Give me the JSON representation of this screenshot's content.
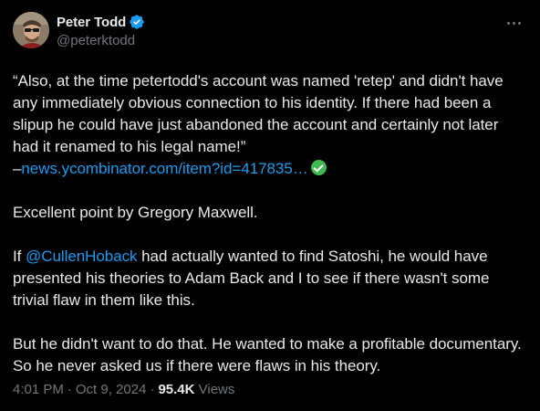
{
  "author": {
    "display_name": "Peter Todd",
    "handle": "@peterktodd"
  },
  "icons": {
    "verified": "verified-badge-icon",
    "more": "more-horizontal-icon",
    "check": "white-check-mark-emoji"
  },
  "colors": {
    "background": "#000000",
    "text": "#e7e9ea",
    "secondary": "#71767b",
    "link": "#1d9bf0",
    "verified": "#1d9bf0",
    "check_emoji": "#3fb950"
  },
  "tweet": {
    "quote": "“Also, at the time petertodd's account was named 'retep' and didn't have any immediately obvious connection to his identity. If there had been a slipup he could have just abandoned the account and certainly not later had it renamed to his legal name!”",
    "source_prefix": "–",
    "source_link": "news.ycombinator.com/item?id=417835…",
    "para2": "Excellent point by Gregory Maxwell.",
    "para3_before": "If ",
    "para3_mention": "@CullenHoback",
    "para3_after": " had actually wanted to find Satoshi, he would have presented his theories to Adam Back and I to see if there wasn't some trivial flaw in them like this.",
    "para4": "But he didn't want to do that. He wanted to make a profitable documentary. So he never asked us if there were flaws in his theory."
  },
  "meta": {
    "time": "4:01 PM",
    "separator": "·",
    "date": "Oct 9, 2024",
    "views_count": "95.4K",
    "views_label": "Views"
  }
}
